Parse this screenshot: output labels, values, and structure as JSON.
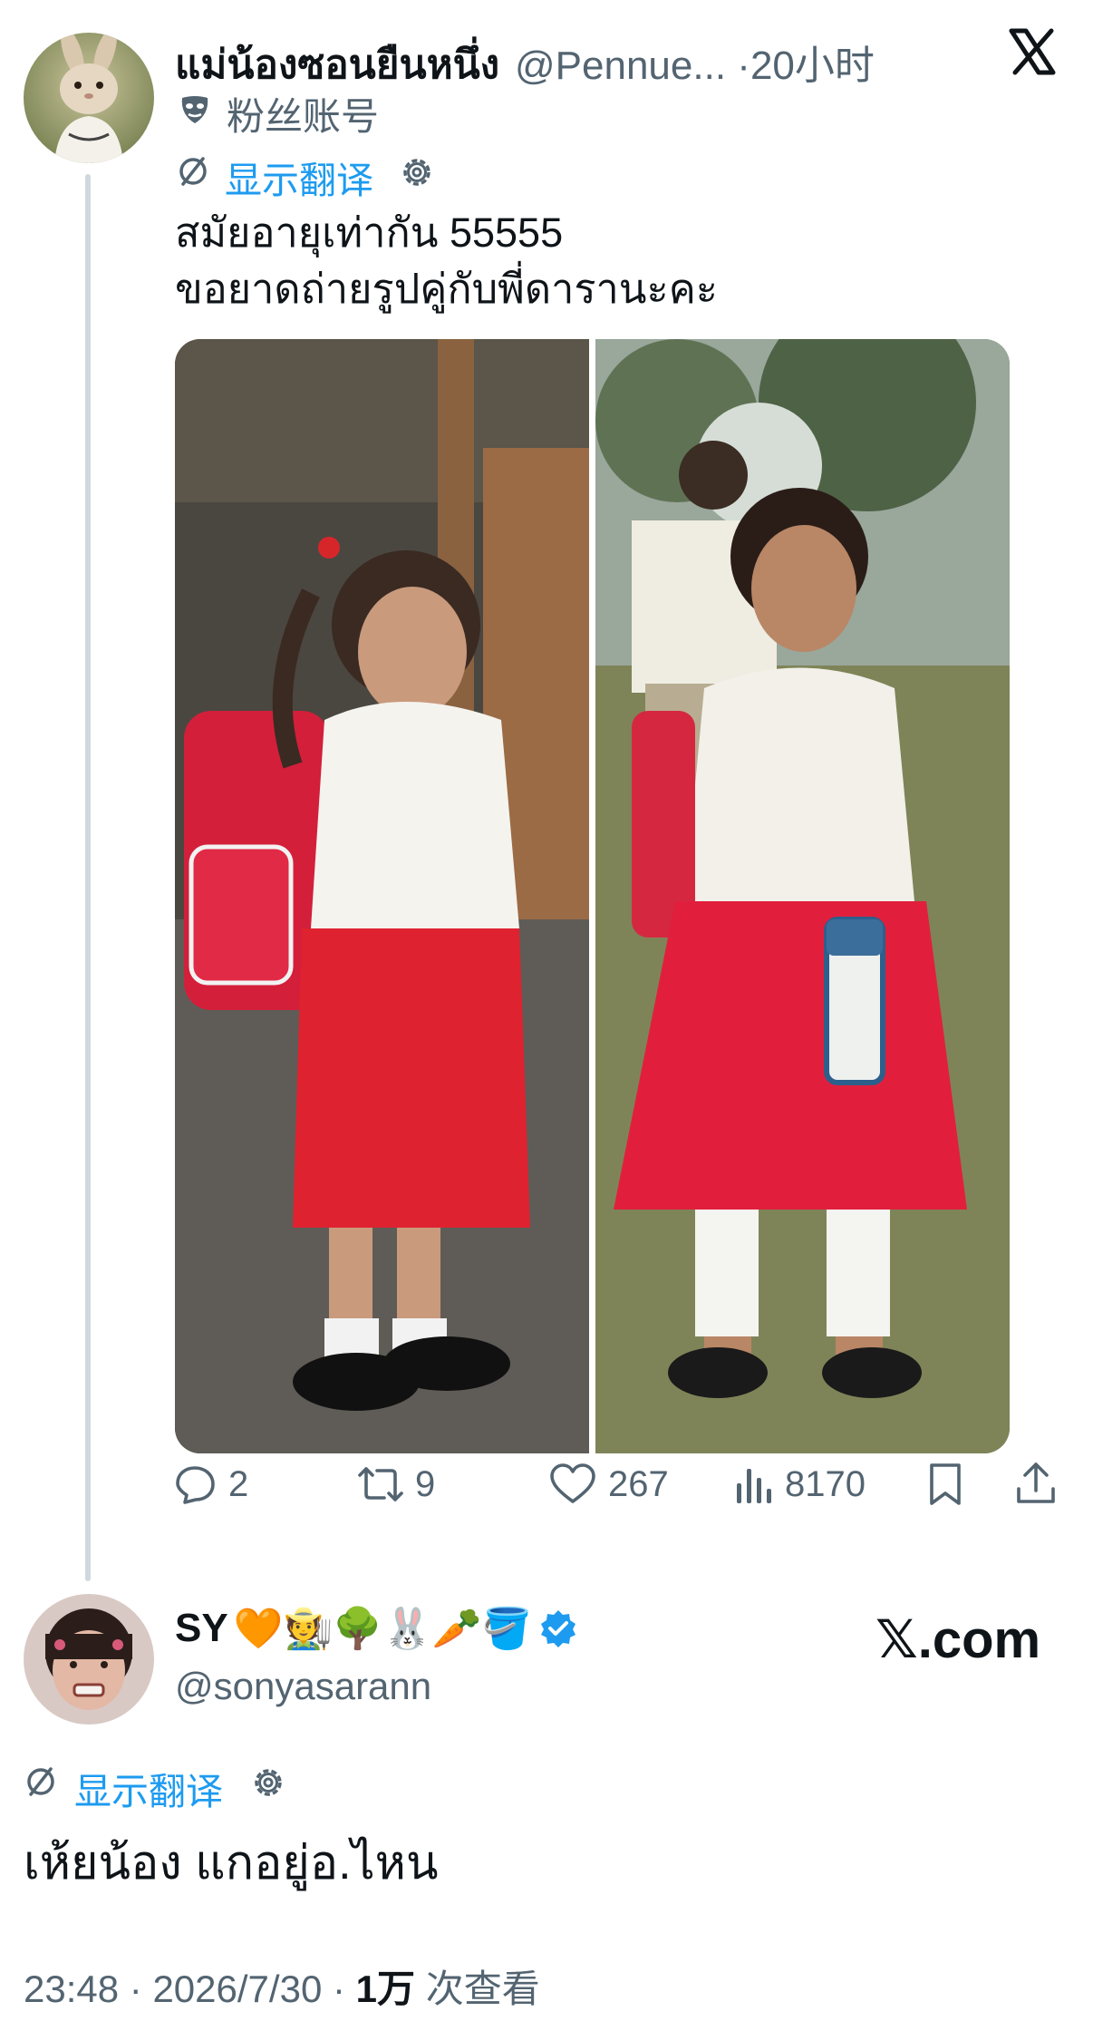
{
  "parent_tweet": {
    "display_name": "แม่น้องซอนยืนหนึ่ง",
    "handle": "@Pennue...",
    "separator": "·",
    "time_ago": "20小时",
    "fan_account_label": "粉丝账号",
    "translate_label": "显示翻译",
    "text_line1": "สมัยอายุเท่ากัน 55555",
    "text_line2": "ขอยาดถ่ายรูปคู่กับพี่ดารานะคะ",
    "actions": {
      "replies": "2",
      "reposts": "9",
      "likes": "267",
      "views": "8170"
    }
  },
  "reply_tweet": {
    "display_name": "SY",
    "name_emoji": "🧡🧑‍🌾🌳🐰🥕🪣",
    "handle": "@sonyasarann",
    "translate_label": "显示翻译",
    "text": "เห้ยน้อง แกอยู่อ.ไหน",
    "timestamp": "23:48",
    "separator": "·",
    "date": "2026/7/30",
    "views_count": "1万",
    "views_label": "次查看"
  },
  "watermark": {
    "logo_letter": "𝕏",
    "domain": ".com"
  },
  "colors": {
    "accent": "#1d9bf0",
    "muted_text": "#536471",
    "thread_line": "#cfd9de",
    "verified": "#1d9bf0"
  },
  "icons": {
    "close": "x-logo-icon",
    "fan": "mask-icon",
    "translate": "translate-icon",
    "settings": "gear-icon",
    "reply": "reply-icon",
    "repost": "repost-icon",
    "like": "heart-icon",
    "views": "views-icon",
    "bookmark": "bookmark-icon",
    "share": "share-icon",
    "verified": "verified-badge-icon"
  }
}
